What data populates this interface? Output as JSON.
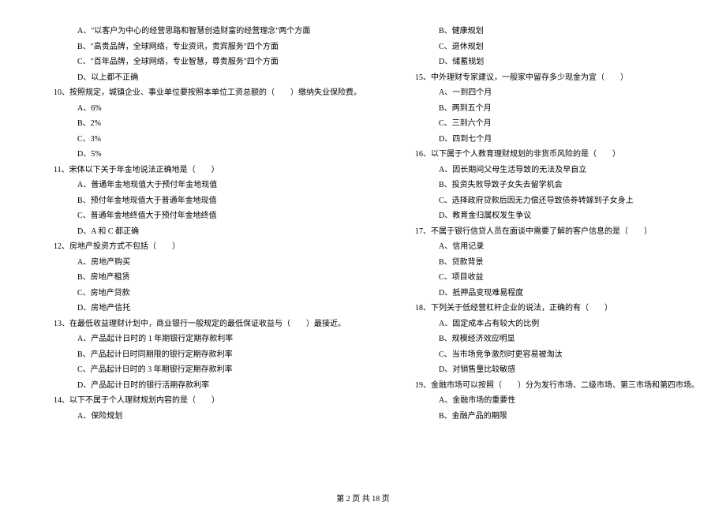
{
  "leftColumn": [
    {
      "type": "option",
      "text": "A、\"以客户为中心的经营思路和智慧创造财富的经营理念\"两个方面"
    },
    {
      "type": "option",
      "text": "B、\"高贵品牌，全球网络，专业资讯，贵宾服务\"四个方面"
    },
    {
      "type": "option",
      "text": "C、\"百年品牌，全球网络，专业智慧，尊贵服务\"四个方面"
    },
    {
      "type": "option",
      "text": "D、以上都不正确"
    },
    {
      "type": "question",
      "text": "10、按照规定，城镇企业、事业单位要按照本单位工资总额的（　　）缴纳失业保险费。"
    },
    {
      "type": "option",
      "text": "A、6%"
    },
    {
      "type": "option",
      "text": "B、2%"
    },
    {
      "type": "option",
      "text": "C、3%"
    },
    {
      "type": "option",
      "text": "D、5%"
    },
    {
      "type": "question",
      "text": "11、宋体以下关于年金地说法正确地是（　　）"
    },
    {
      "type": "option",
      "text": "A、普通年金地现值大于预付年金地现值"
    },
    {
      "type": "option",
      "text": "B、预付年金地现值大于普通年金地现值"
    },
    {
      "type": "option",
      "text": "C、普通年金地终值大于预付年金地终值"
    },
    {
      "type": "option",
      "text": "D、A 和 C 都正确"
    },
    {
      "type": "question",
      "text": "12、房地产投资方式不包括（　　）"
    },
    {
      "type": "option",
      "text": "A、房地产购买"
    },
    {
      "type": "option",
      "text": "B、房地产租赁"
    },
    {
      "type": "option",
      "text": "C、房地产贷款"
    },
    {
      "type": "option",
      "text": "D、房地产信托"
    },
    {
      "type": "question",
      "text": "13、在最低收益理财计划中，商业银行一般规定的最低保证收益与（　　）最接近。"
    },
    {
      "type": "option",
      "text": "A、产品起计日时的 1 年期银行定期存款利率"
    },
    {
      "type": "option",
      "text": "B、产品起计日时同期限的银行定期存款利率"
    },
    {
      "type": "option",
      "text": "C、产品起计日时的 3 年期银行定期存款利率"
    },
    {
      "type": "option",
      "text": "D、产品起计日时的银行活期存款利率"
    },
    {
      "type": "question",
      "text": "14、以下不属于个人理财规划内容的是（　　）"
    },
    {
      "type": "option",
      "text": "A、保险规划"
    }
  ],
  "rightColumn": [
    {
      "type": "option",
      "text": "B、健康规划"
    },
    {
      "type": "option",
      "text": "C、退休规划"
    },
    {
      "type": "option",
      "text": "D、储蓄规划"
    },
    {
      "type": "question",
      "text": "15、中外理财专家建议，一般家中留存多少现金为宜（　　）"
    },
    {
      "type": "option",
      "text": "A、一到四个月"
    },
    {
      "type": "option",
      "text": "B、两到五个月"
    },
    {
      "type": "option",
      "text": "C、三到六个月"
    },
    {
      "type": "option",
      "text": "D、四到七个月"
    },
    {
      "type": "question",
      "text": "16、以下属于个人教育理财规划的非货币风险的是（　　）"
    },
    {
      "type": "option",
      "text": "A、因长期间父母生活导致的无法及早自立"
    },
    {
      "type": "option",
      "text": "B、投资失败导致子女失去留学机会"
    },
    {
      "type": "option",
      "text": "C、选择政府贷款后因无力偿还导致债券转嫁到子女身上"
    },
    {
      "type": "option",
      "text": "D、教育金归属权发生争议"
    },
    {
      "type": "question",
      "text": "17、不属于银行信贷人员在面谈中需要了解的客户信息的是（　　）"
    },
    {
      "type": "option",
      "text": "A、信用记录"
    },
    {
      "type": "option",
      "text": "B、贷款背景"
    },
    {
      "type": "option",
      "text": "C、项目收益"
    },
    {
      "type": "option",
      "text": "D、抵押品变现难易程度"
    },
    {
      "type": "question",
      "text": "18、下列关于低经营杠杆企业的说法，正确的有（　　）"
    },
    {
      "type": "option",
      "text": "A、固定成本占有较大的比例"
    },
    {
      "type": "option",
      "text": "B、规模经济效应明显"
    },
    {
      "type": "option",
      "text": "C、当市场竞争激烈时更容易被淘汰"
    },
    {
      "type": "option",
      "text": "D、对销售量比较敏感"
    },
    {
      "type": "question",
      "text": "19、金融市场可以按照（　　）分为发行市场、二级市场、第三市场和第四市场。"
    },
    {
      "type": "option",
      "text": "A、金融市场的重要性"
    },
    {
      "type": "option",
      "text": "B、金融产品的期限"
    }
  ],
  "footer": "第 2 页 共 18 页"
}
